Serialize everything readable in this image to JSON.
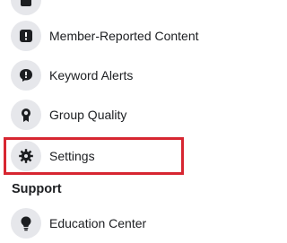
{
  "menu": {
    "items": [
      {
        "label": "Member-Reported Content",
        "icon": "alert-icon"
      },
      {
        "label": "Keyword Alerts",
        "icon": "speech-alert-icon"
      },
      {
        "label": "Group Quality",
        "icon": "badge-icon"
      },
      {
        "label": "Settings",
        "icon": "gear-icon",
        "highlighted": true
      }
    ]
  },
  "support": {
    "title": "Support",
    "items": [
      {
        "label": "Education Center",
        "icon": "lightbulb-icon"
      }
    ]
  },
  "colors": {
    "highlight_border": "#d72631",
    "icon_bg": "#e6e7eb",
    "text": "#1c1e21"
  }
}
